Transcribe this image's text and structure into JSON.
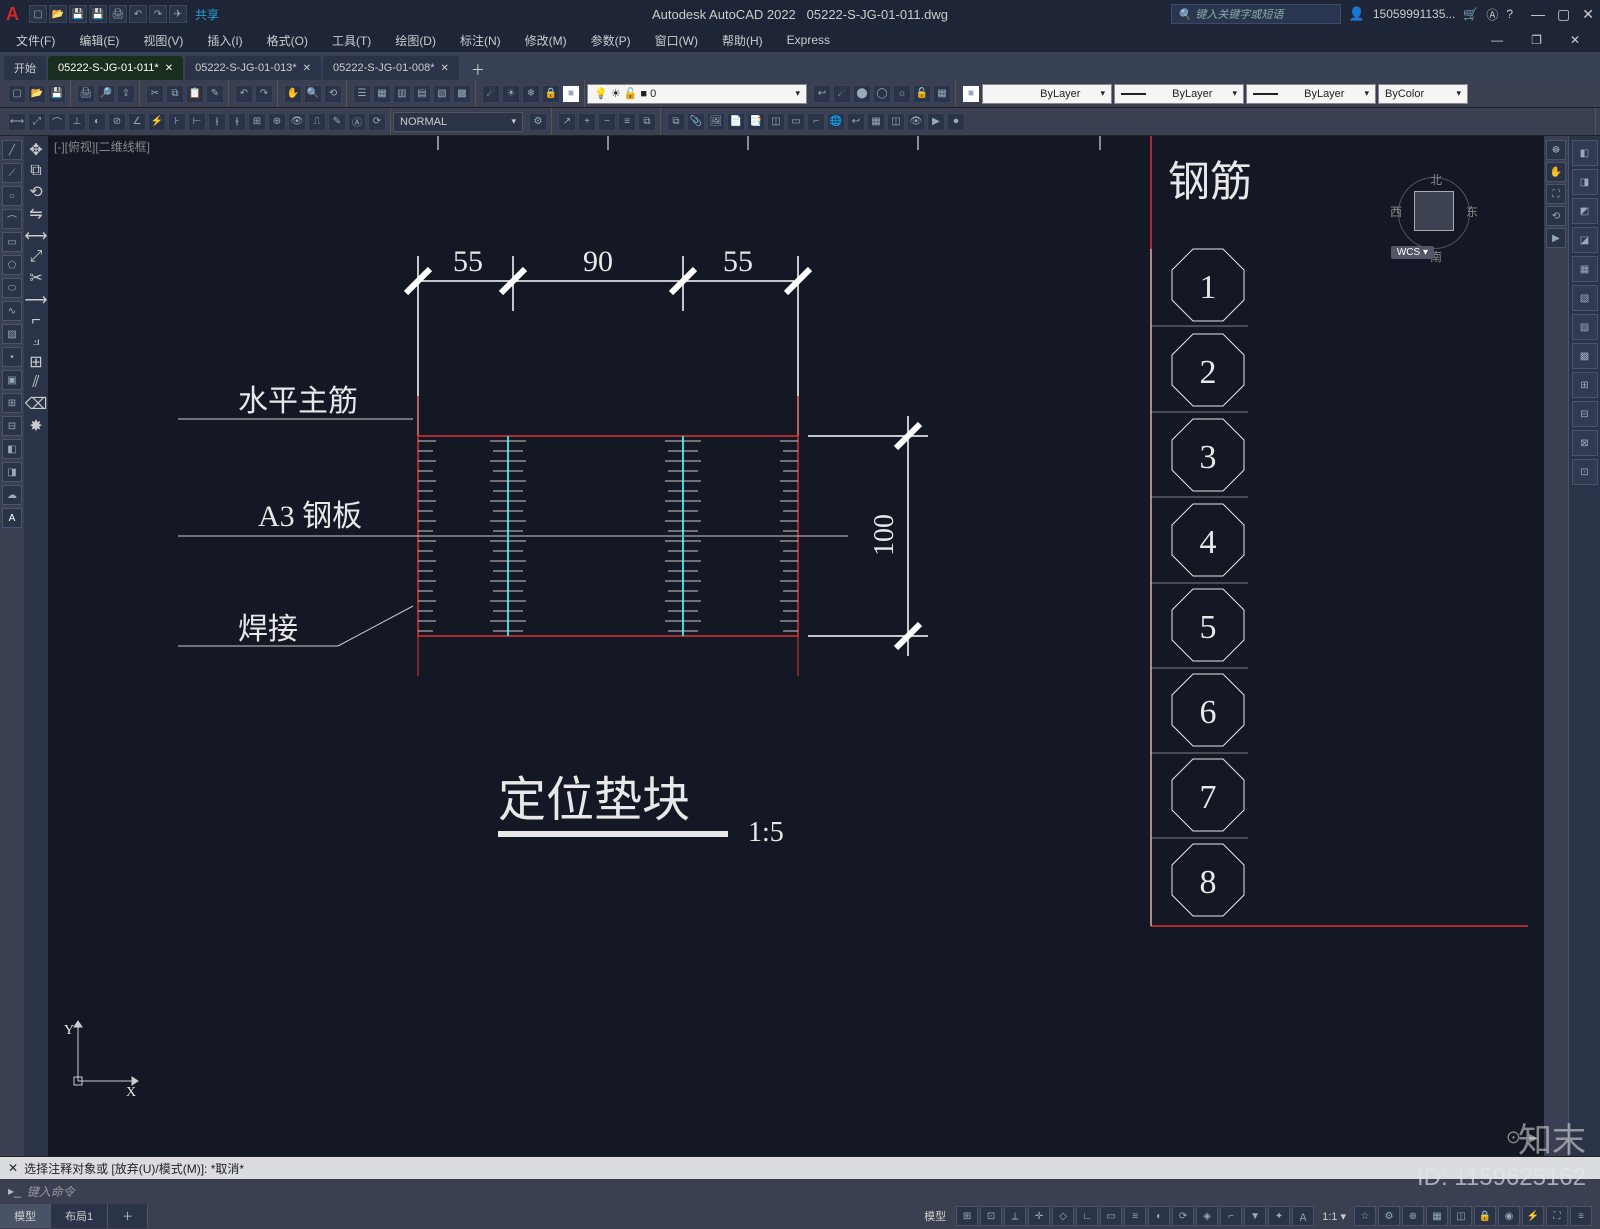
{
  "app": {
    "title": "Autodesk AutoCAD 2022",
    "doc": "05222-S-JG-01-011.dwg",
    "share": "共享",
    "user": "15059991135..."
  },
  "search": {
    "placeholder": "键入关键字或短语"
  },
  "menus": [
    "文件(F)",
    "编辑(E)",
    "视图(V)",
    "插入(I)",
    "格式(O)",
    "工具(T)",
    "绘图(D)",
    "标注(N)",
    "修改(M)",
    "参数(P)",
    "窗口(W)",
    "帮助(H)",
    "Express"
  ],
  "start_tab": "开始",
  "file_tabs": [
    {
      "name": "05222-S-JG-01-011*",
      "active": true
    },
    {
      "name": "05222-S-JG-01-013*",
      "active": false
    },
    {
      "name": "05222-S-JG-01-008*",
      "active": false
    }
  ],
  "layer": {
    "current": "0"
  },
  "style_combo": "NORMAL",
  "props": {
    "color": "ByLayer",
    "ltype": "ByLayer",
    "lweight": "ByLayer",
    "bycolor": "ByColor"
  },
  "viewport_label": "[-][俯视][二维线框]",
  "viewcube": {
    "n": "北",
    "s": "南",
    "e": "东",
    "w": "西"
  },
  "wcs": "WCS",
  "drawing": {
    "title": "定位垫块",
    "scale": "1:5",
    "corner_text": "钢筋",
    "dims_top": [
      "55",
      "90",
      "55"
    ],
    "dim_right": "100",
    "labels": {
      "l1": "水平主筋",
      "l2": "A3 钢板",
      "l3": "焊接"
    },
    "right_refs": [
      "1",
      "2",
      "3",
      "4",
      "5",
      "6",
      "7",
      "8"
    ],
    "ucs": {
      "x": "X",
      "y": "Y"
    }
  },
  "cmd": {
    "history": "选择注释对象或 [放弃(U)/模式(M)]: *取消*",
    "prompt": "键入命令"
  },
  "status": {
    "tabs": [
      "模型",
      "布局1"
    ],
    "label_model": "模型"
  },
  "footer": {
    "brand": "知末",
    "id": "ID: 1159625162"
  }
}
